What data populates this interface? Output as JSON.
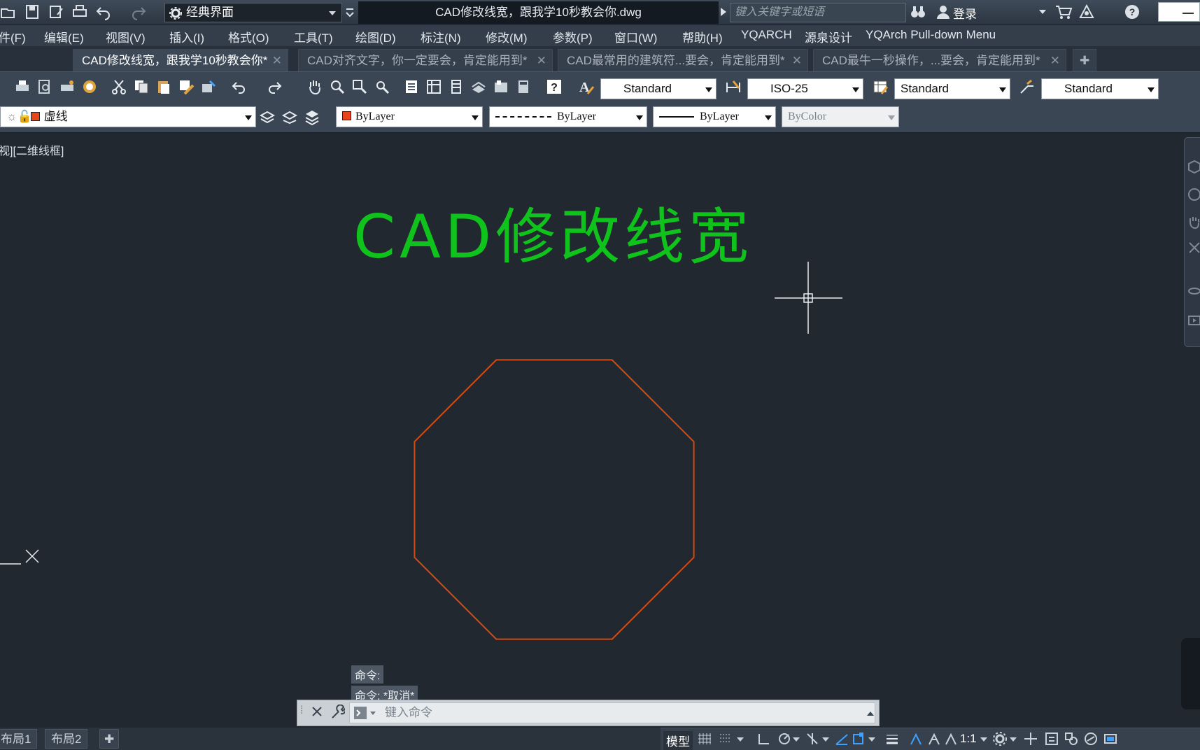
{
  "titlebar": {
    "workspace": "经典界面",
    "document_title": "CAD修改线宽，跟我学10秒教会你.dwg",
    "search_placeholder": "键入关键字或短语",
    "login": "登录"
  },
  "menubar": [
    "件(F)",
    "编辑(E)",
    "视图(V)",
    "插入(I)",
    "格式(O)",
    "工具(T)",
    "绘图(D)",
    "标注(N)",
    "修改(M)",
    "参数(P)",
    "窗口(W)",
    "帮助(H)",
    "YQARCH",
    "源泉设计",
    "YQArch Pull-down Menu"
  ],
  "tabs": [
    {
      "label": "CAD修改线宽，跟我学10秒教会你*",
      "active": true
    },
    {
      "label": "CAD对齐文字，你一定要会，肯定能用到*",
      "active": false
    },
    {
      "label": "CAD最常用的建筑符...要会，肯定能用到*",
      "active": false
    },
    {
      "label": "CAD最牛一秒操作，...要会，肯定能用到*",
      "active": false
    }
  ],
  "styles_toolbar": {
    "text_style": "Standard",
    "dim_style": "ISO-25",
    "table_style": "Standard",
    "mleader_style": "Standard"
  },
  "properties_toolbar": {
    "layer": "虚线",
    "color": "ByLayer",
    "linetype": "ByLayer",
    "lineweight": "ByLayer",
    "plotstyle": "ByColor"
  },
  "viewport": {
    "label": "视][二维线框]",
    "title_text": "CAD修改线宽"
  },
  "command_line": {
    "history": [
      "命令:",
      "命令: *取消*"
    ],
    "placeholder": "键入命令"
  },
  "layout_tabs": [
    "布局1",
    "布局2"
  ],
  "status_bar": {
    "model": "模型",
    "scale": "1:1"
  },
  "colors": {
    "canvas_bg": "#212830",
    "title_text_green": "#10c21c",
    "octagon_orange": "#d44a13",
    "layer_swatch": "#e8451c"
  }
}
